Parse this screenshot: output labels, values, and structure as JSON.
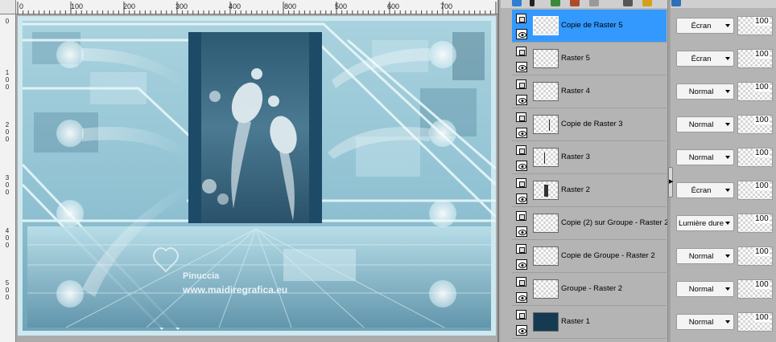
{
  "rulers": {
    "horizontal_ticks": [
      "0",
      "100",
      "200",
      "300",
      "400",
      "500",
      "600",
      "700",
      "800"
    ],
    "vertical_ticks": [
      [
        "0"
      ],
      [
        "1",
        "0",
        "0"
      ],
      [
        "2",
        "0",
        "0"
      ],
      [
        "3",
        "0",
        "0"
      ],
      [
        "4",
        "0",
        "0"
      ],
      [
        "5",
        "0",
        "0"
      ]
    ]
  },
  "artwork": {
    "watermark_line1": "Pinuccia",
    "watermark_line2": "www.maidiregrafica.eu"
  },
  "layers": [
    {
      "name": "Copie de Raster 5",
      "blend": "Écran",
      "opacity": "100",
      "selected": true,
      "thumb": "selected"
    },
    {
      "name": "Raster 5",
      "blend": "Écran",
      "opacity": "100",
      "selected": false,
      "thumb": "empty"
    },
    {
      "name": "Raster 4",
      "blend": "Normal",
      "opacity": "100",
      "selected": false,
      "thumb": "empty"
    },
    {
      "name": "Copie de Raster 3",
      "blend": "Normal",
      "opacity": "100",
      "selected": false,
      "thumb": "mark"
    },
    {
      "name": "Raster 3",
      "blend": "Normal",
      "opacity": "100",
      "selected": false,
      "thumb": "mark-left"
    },
    {
      "name": "Raster 2",
      "blend": "Écran",
      "opacity": "100",
      "selected": false,
      "thumb": "dark"
    },
    {
      "name": "Copie (2) sur Groupe - Raster 2",
      "blend": "Lumière dure",
      "opacity": "100",
      "selected": false,
      "thumb": "empty"
    },
    {
      "name": "Copie de Groupe - Raster 2",
      "blend": "Normal",
      "opacity": "100",
      "selected": false,
      "thumb": "empty"
    },
    {
      "name": "Groupe - Raster 2",
      "blend": "Normal",
      "opacity": "100",
      "selected": false,
      "thumb": "empty"
    },
    {
      "name": "Raster 1",
      "blend": "Normal",
      "opacity": "100",
      "selected": false,
      "thumb": "solid"
    }
  ],
  "colors": {
    "selection": "#3399ff",
    "raster1": "#163a52",
    "art_light": "#bfe3ec",
    "art_mid": "#7fb6c8",
    "art_dark": "#2b5a72"
  }
}
